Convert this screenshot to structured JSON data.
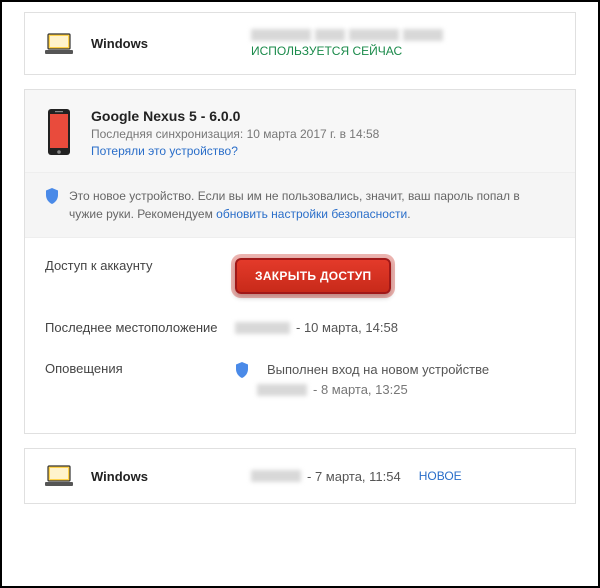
{
  "devices": {
    "top": {
      "name": "Windows",
      "status": "ИСПОЛЬЗУЕТСЯ СЕЙЧАС"
    },
    "bottom": {
      "name": "Windows",
      "date": "- 7 марта, 11:54",
      "badge": "НОВОЕ"
    }
  },
  "detail": {
    "title": "Google Nexus 5 - 6.0.0",
    "last_sync": "Последняя синхронизация: 10 марта 2017 г. в 14:58",
    "lost_link": "Потеряли это устройство?",
    "info_prefix": "Это новое устройство. Если вы им не пользовались, значит, ваш пароль попал в чужие руки. Рекомендуем ",
    "info_link": "обновить настройки безопасности",
    "info_suffix": ".",
    "rows": {
      "access_label": "Доступ к аккаунту",
      "revoke_button": "ЗАКРЫТЬ ДОСТУП",
      "location_label": "Последнее местоположение",
      "location_value": "- 10 марта, 14:58",
      "notif_label": "Оповещения",
      "notif_text": "Выполнен вход на новом устройстве",
      "notif_date": "- 8 марта, 13:25"
    }
  }
}
